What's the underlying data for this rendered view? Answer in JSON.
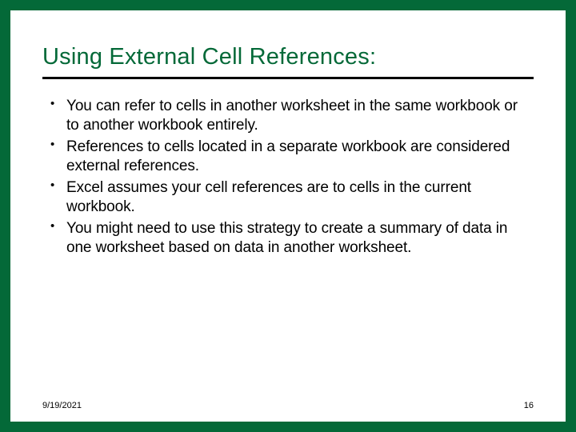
{
  "slide": {
    "title": "Using External Cell References:",
    "bullets": [
      "You can refer to cells in another worksheet in the same workbook or to another workbook entirely.",
      "References to cells located in a separate workbook are considered external references.",
      "Excel assumes your cell references are to cells in the current workbook.",
      "You might need to use this strategy to create a summary of data in one worksheet based on data in another worksheet."
    ],
    "date": "9/19/2021",
    "page_number": "16"
  }
}
